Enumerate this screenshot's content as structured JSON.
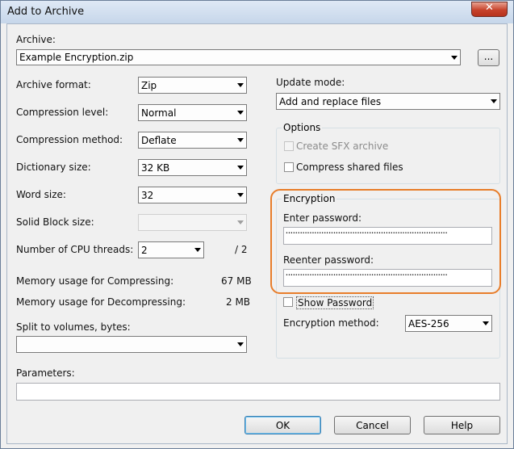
{
  "window": {
    "title": "Add to Archive",
    "close_glyph": "✕"
  },
  "archive": {
    "label": "Archive:",
    "value": "Example Encryption.zip",
    "browse_label": "..."
  },
  "left": {
    "format": {
      "label": "Archive format:",
      "value": "Zip"
    },
    "compression_level": {
      "label": "Compression level:",
      "value": "Normal"
    },
    "compression_method": {
      "label": "Compression method:",
      "value": "Deflate"
    },
    "dictionary_size": {
      "label": "Dictionary size:",
      "value": "32 KB"
    },
    "word_size": {
      "label": "Word size:",
      "value": "32"
    },
    "solid_block": {
      "label": "Solid Block size:",
      "value": ""
    },
    "cpu_threads": {
      "label": "Number of CPU threads:",
      "value": "2",
      "max": "/ 2"
    },
    "mem_compress": {
      "label": "Memory usage for Compressing:",
      "value": "67 MB"
    },
    "mem_decompress": {
      "label": "Memory usage for Decompressing:",
      "value": "2 MB"
    },
    "split": {
      "label": "Split to volumes, bytes:",
      "value": ""
    }
  },
  "parameters": {
    "label": "Parameters:",
    "value": ""
  },
  "right": {
    "update_mode": {
      "label": "Update mode:",
      "value": "Add and replace files"
    },
    "options": {
      "title": "Options",
      "sfx_label": "Create SFX archive",
      "compress_shared_label": "Compress shared files"
    },
    "encryption": {
      "title": "Encryption",
      "enter_label": "Enter password:",
      "enter_value": "••••••••••••••••••••••••••••••••••••••••••••••••••••••••••••••••••••••••••••••••••",
      "reenter_label": "Reenter password:",
      "reenter_value": "••••••••••••••••••••••••••••••••••••••••••••••••••••••••••••••••••••••••••••••••••",
      "show_password_label": "Show Password",
      "method_label": "Encryption method:",
      "method_value": "AES-256"
    }
  },
  "buttons": {
    "ok": "OK",
    "cancel": "Cancel",
    "help": "Help"
  },
  "colors": {
    "highlight": "#e87d2a",
    "title_bg": "#c6d6ea"
  }
}
